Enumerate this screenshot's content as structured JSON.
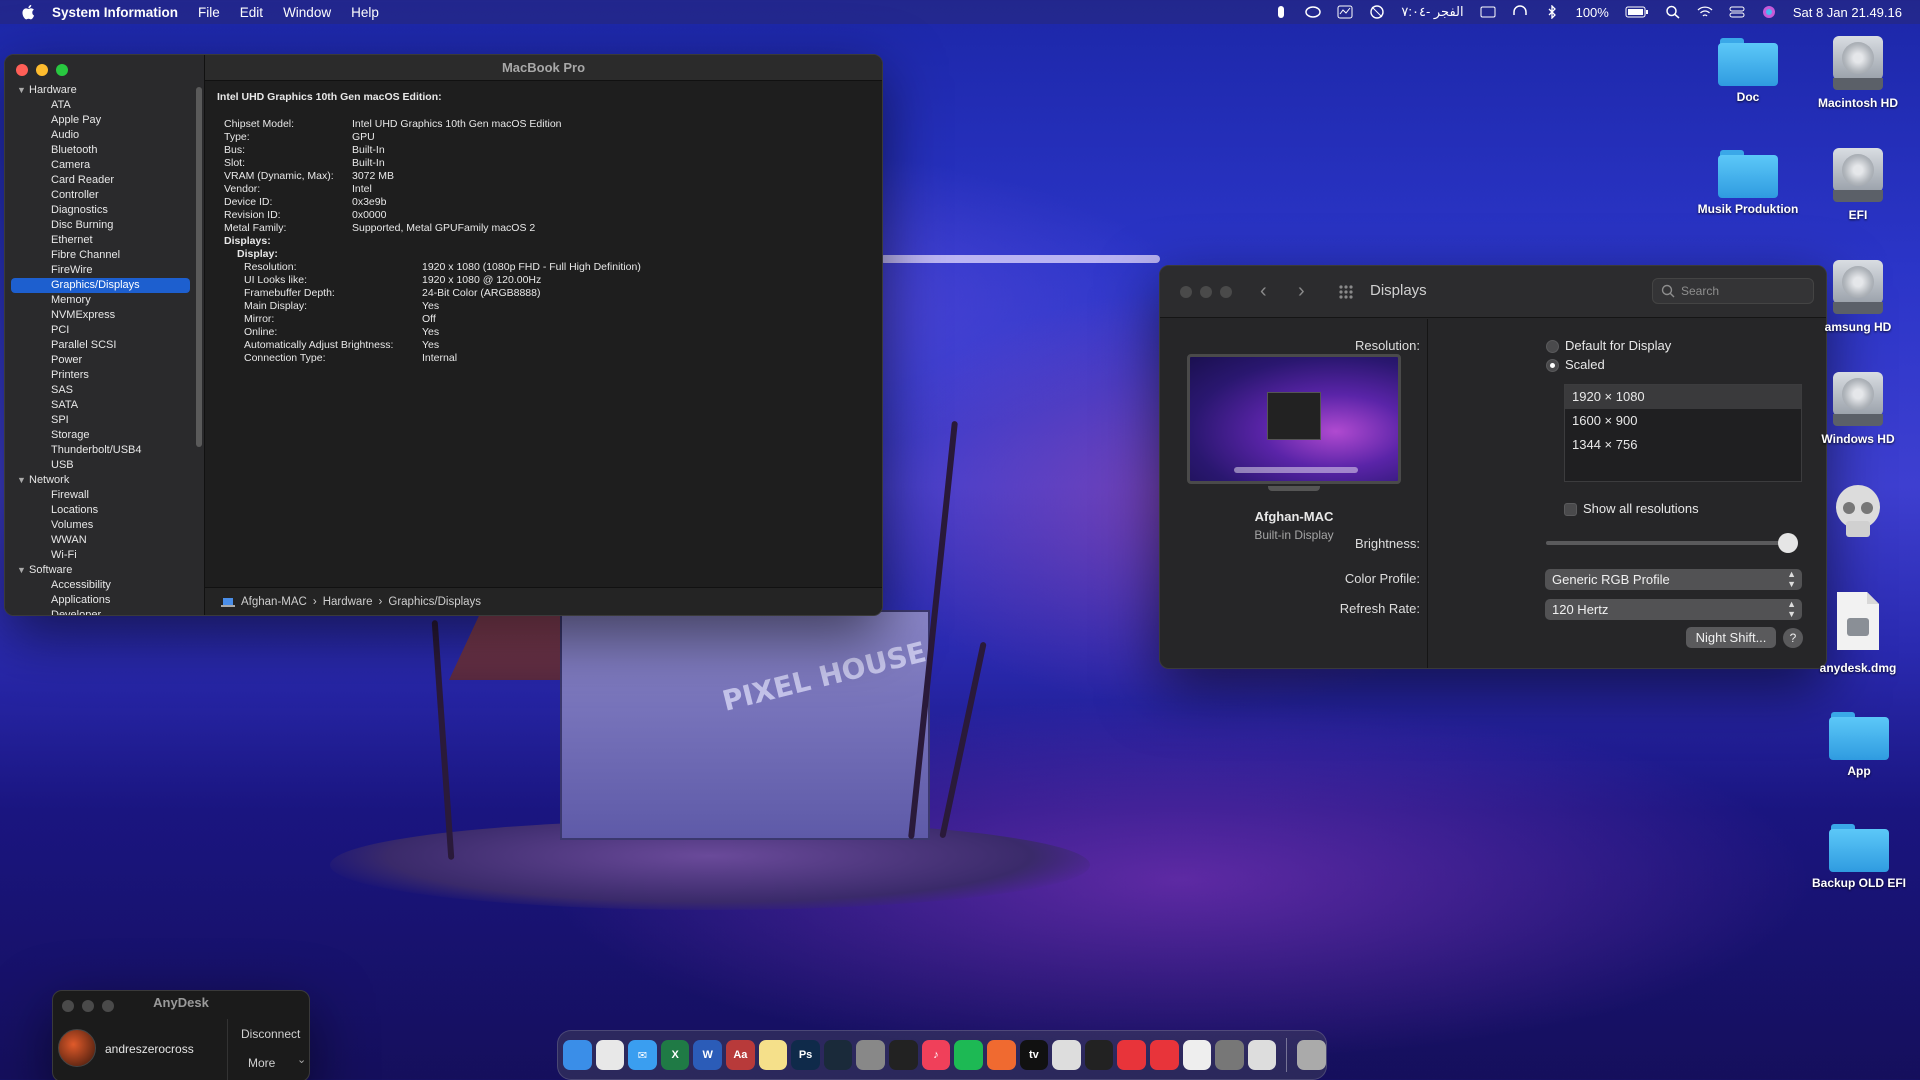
{
  "menubar": {
    "app_name": "System Information",
    "menus": [
      "File",
      "Edit",
      "Window",
      "Help"
    ],
    "prayer": "الفجر -٧:٠٤",
    "battery": "100%",
    "datetime": "Sat 8 Jan  21.49.16"
  },
  "sysinfo": {
    "window_title": "MacBook Pro",
    "sidebar": [
      {
        "type": "group",
        "label": "Hardware"
      },
      {
        "type": "item",
        "label": "ATA"
      },
      {
        "type": "item",
        "label": "Apple Pay"
      },
      {
        "type": "item",
        "label": "Audio"
      },
      {
        "type": "item",
        "label": "Bluetooth"
      },
      {
        "type": "item",
        "label": "Camera"
      },
      {
        "type": "item",
        "label": "Card Reader"
      },
      {
        "type": "item",
        "label": "Controller"
      },
      {
        "type": "item",
        "label": "Diagnostics"
      },
      {
        "type": "item",
        "label": "Disc Burning"
      },
      {
        "type": "item",
        "label": "Ethernet"
      },
      {
        "type": "item",
        "label": "Fibre Channel"
      },
      {
        "type": "item",
        "label": "FireWire"
      },
      {
        "type": "item",
        "label": "Graphics/Displays",
        "selected": true
      },
      {
        "type": "item",
        "label": "Memory"
      },
      {
        "type": "item",
        "label": "NVMExpress"
      },
      {
        "type": "item",
        "label": "PCI"
      },
      {
        "type": "item",
        "label": "Parallel SCSI"
      },
      {
        "type": "item",
        "label": "Power"
      },
      {
        "type": "item",
        "label": "Printers"
      },
      {
        "type": "item",
        "label": "SAS"
      },
      {
        "type": "item",
        "label": "SATA"
      },
      {
        "type": "item",
        "label": "SPI"
      },
      {
        "type": "item",
        "label": "Storage"
      },
      {
        "type": "item",
        "label": "Thunderbolt/USB4"
      },
      {
        "type": "item",
        "label": "USB"
      },
      {
        "type": "group",
        "label": "Network"
      },
      {
        "type": "item",
        "label": "Firewall"
      },
      {
        "type": "item",
        "label": "Locations"
      },
      {
        "type": "item",
        "label": "Volumes"
      },
      {
        "type": "item",
        "label": "WWAN"
      },
      {
        "type": "item",
        "label": "Wi-Fi"
      },
      {
        "type": "group",
        "label": "Software"
      },
      {
        "type": "item",
        "label": "Accessibility"
      },
      {
        "type": "item",
        "label": "Applications"
      },
      {
        "type": "item",
        "label": "Developer"
      }
    ],
    "heading": "Intel UHD Graphics 10th Gen macOS Edition:",
    "props": [
      {
        "k": "Chipset Model:",
        "v": "Intel UHD Graphics 10th Gen macOS Edition"
      },
      {
        "k": "Type:",
        "v": "GPU"
      },
      {
        "k": "Bus:",
        "v": "Built-In"
      },
      {
        "k": "Slot:",
        "v": "Built-In"
      },
      {
        "k": "VRAM (Dynamic, Max):",
        "v": "3072 MB"
      },
      {
        "k": "Vendor:",
        "v": "Intel"
      },
      {
        "k": "Device ID:",
        "v": "0x3e9b"
      },
      {
        "k": "Revision ID:",
        "v": "0x0000"
      },
      {
        "k": "Metal Family:",
        "v": "Supported, Metal GPUFamily macOS 2"
      }
    ],
    "displays_label": "Displays:",
    "display_label": "Display:",
    "display_props": [
      {
        "k": "Resolution:",
        "v": "1920 x 1080 (1080p FHD - Full High Definition)"
      },
      {
        "k": "UI Looks like:",
        "v": "1920 x 1080 @ 120.00Hz"
      },
      {
        "k": "Framebuffer Depth:",
        "v": "24-Bit Color (ARGB8888)"
      },
      {
        "k": "Main Display:",
        "v": "Yes"
      },
      {
        "k": "Mirror:",
        "v": "Off"
      },
      {
        "k": "Online:",
        "v": "Yes"
      },
      {
        "k": "Automatically Adjust Brightness:",
        "v": "Yes"
      },
      {
        "k": "Connection Type:",
        "v": "Internal"
      }
    ],
    "path": [
      "Afghan-MAC",
      "Hardware",
      "Graphics/Displays"
    ]
  },
  "displays": {
    "title": "Displays",
    "search_placeholder": "Search",
    "display_name": "Afghan-MAC",
    "display_sub": "Built-in Display",
    "resolution_label": "Resolution:",
    "opt_default": "Default for Display",
    "opt_scaled": "Scaled",
    "resolutions": [
      "1920 × 1080",
      "1600 × 900",
      "1344 × 756"
    ],
    "show_all": "Show all resolutions",
    "brightness_label": "Brightness:",
    "brightness_level": 1.0,
    "color_profile_label": "Color Profile:",
    "color_profile": "Generic RGB Profile",
    "refresh_label": "Refresh Rate:",
    "refresh": "120 Hertz",
    "night_shift": "Night Shift...",
    "help": "?"
  },
  "desktop_icons": [
    {
      "label": "Doc",
      "kind": "folder"
    },
    {
      "label": "Macintosh HD",
      "kind": "drive"
    },
    {
      "label": "Musik Produktion",
      "kind": "folder"
    },
    {
      "label": "EFI",
      "kind": "drive"
    },
    {
      "label": "amsung HD",
      "kind": "drive"
    },
    {
      "label": "Windows HD",
      "kind": "drive"
    },
    {
      "label": "anydesk.dmg",
      "kind": "dmg"
    },
    {
      "label": "App",
      "kind": "folder"
    },
    {
      "label": "Backup OLD EFI",
      "kind": "folder"
    }
  ],
  "anydesk": {
    "title": "AnyDesk",
    "user": "andreszerocross",
    "disconnect": "Disconnect",
    "more": "More"
  },
  "wallpaper_sign": "PIXEL HOUSE",
  "dock": [
    {
      "name": "finder",
      "glyph": "",
      "color": "#3a8ee8"
    },
    {
      "name": "chrome",
      "glyph": "",
      "color": "#e8e8e8"
    },
    {
      "name": "mail",
      "glyph": "✉",
      "color": "#3a9ef0"
    },
    {
      "name": "excel",
      "glyph": "X",
      "color": "#1f7a45"
    },
    {
      "name": "word",
      "glyph": "W",
      "color": "#2b5cb8"
    },
    {
      "name": "dictionary",
      "glyph": "Aa",
      "color": "#b83a3a"
    },
    {
      "name": "notes",
      "glyph": "",
      "color": "#f5e08a"
    },
    {
      "name": "photoshop",
      "glyph": "Ps",
      "color": "#0f2a4a"
    },
    {
      "name": "steam",
      "glyph": "",
      "color": "#1a2a3a"
    },
    {
      "name": "disk-utility",
      "glyph": "",
      "color": "#888"
    },
    {
      "name": "final-cut",
      "glyph": "",
      "color": "#222"
    },
    {
      "name": "music",
      "glyph": "♪",
      "color": "#f0405a"
    },
    {
      "name": "spotify",
      "glyph": "",
      "color": "#1db954"
    },
    {
      "name": "swift",
      "glyph": "",
      "color": "#f06a30"
    },
    {
      "name": "apple-tv",
      "glyph": "tv",
      "color": "#111"
    },
    {
      "name": "opencore-configurator",
      "glyph": "",
      "color": "#ddd"
    },
    {
      "name": "hackintool",
      "glyph": "",
      "color": "#222"
    },
    {
      "name": "anydesk",
      "glyph": "",
      "color": "#e8343a"
    },
    {
      "name": "anydesk-2",
      "glyph": "",
      "color": "#e8343a"
    },
    {
      "name": "textedit",
      "glyph": "",
      "color": "#eee"
    },
    {
      "name": "system-preferences",
      "glyph": "",
      "color": "#777"
    },
    {
      "name": "app-store-like",
      "glyph": "",
      "color": "#ddd"
    },
    {
      "name": "trash",
      "glyph": "",
      "color": "#aaa"
    }
  ]
}
